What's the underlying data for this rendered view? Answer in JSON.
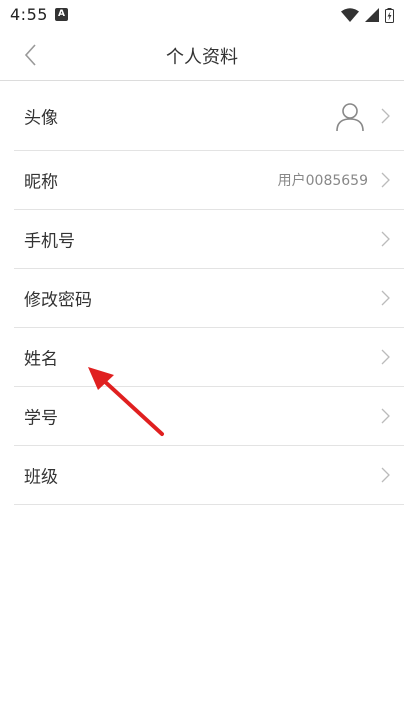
{
  "status_bar": {
    "time": "4:55",
    "notification_badge": "A"
  },
  "header": {
    "title": "个人资料"
  },
  "profile_rows": [
    {
      "label": "头像",
      "value": "",
      "icon": "user-avatar-icon"
    },
    {
      "label": "昵称",
      "value": "用户0085659"
    },
    {
      "label": "手机号",
      "value": ""
    },
    {
      "label": "修改密码",
      "value": ""
    },
    {
      "label": "姓名",
      "value": ""
    },
    {
      "label": "学号",
      "value": ""
    },
    {
      "label": "班级",
      "value": ""
    }
  ],
  "colors": {
    "annotation_arrow": "#e02020",
    "label_text": "#333333",
    "value_text": "#888888",
    "divider": "#e3e3e3"
  }
}
